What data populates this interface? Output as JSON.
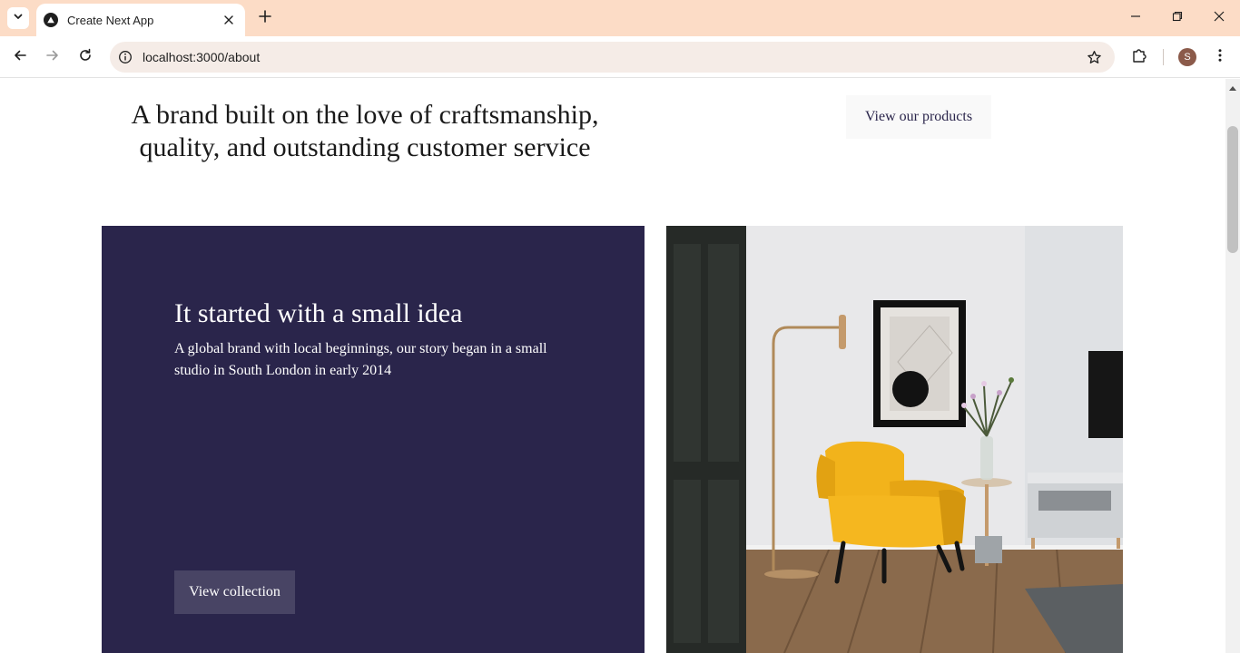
{
  "browser": {
    "tab_title": "Create Next App",
    "url": "localhost:3000/about",
    "profile_initial": "S",
    "theme_color": "#fcdcc6"
  },
  "icons": {
    "tab_search": "chevron-down-icon",
    "favicon": "nextjs-logo-icon",
    "tab_close": "close-icon",
    "new_tab": "plus-icon",
    "minimize": "minimize-icon",
    "restore": "restore-icon",
    "close_window": "close-icon",
    "back": "arrow-left-icon",
    "forward": "arrow-right-icon",
    "reload": "reload-icon",
    "site_info": "info-icon",
    "bookmark": "star-icon",
    "extensions": "puzzle-icon",
    "menu": "kebab-menu-icon"
  },
  "page": {
    "hero_text": "A brand built on the love of craftsmanship, quality, and outstanding customer service",
    "products_button": "View our products",
    "story": {
      "title": "It started with a small idea",
      "body": "A global brand with local beginnings, our story began in a small studio in South London in early 2014",
      "button": "View collection"
    },
    "colors": {
      "primary": "#2a254b",
      "light_button": "#f9f9f9",
      "text": "#1a1a1a"
    },
    "image": "interior-photo-yellow-armchair"
  }
}
